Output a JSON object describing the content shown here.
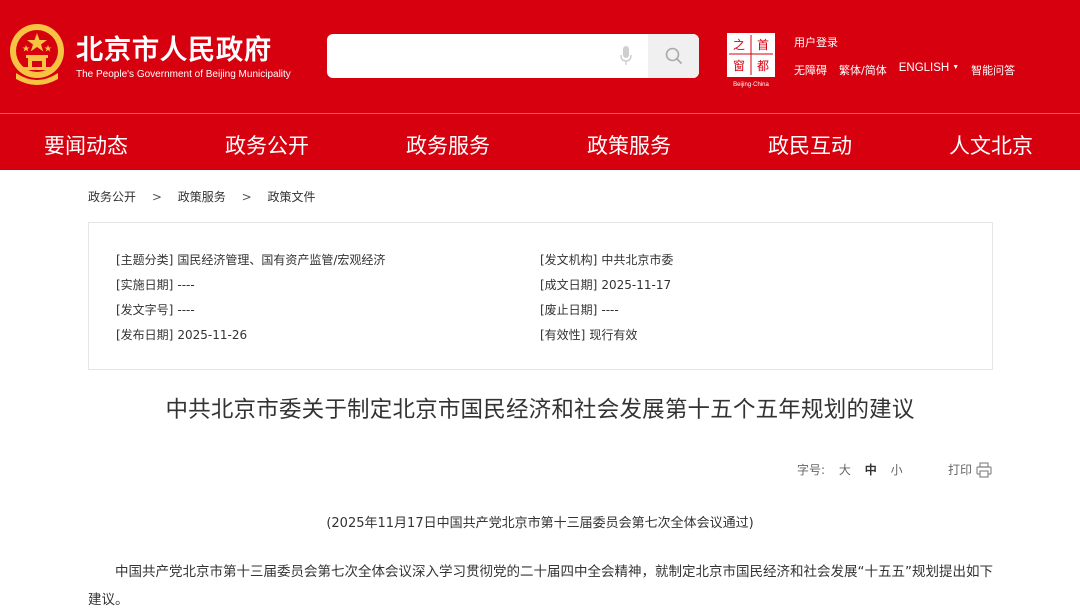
{
  "header": {
    "title": "北京市人民政府",
    "subtitle": "The People's Government of Beijing Municipality",
    "search": {
      "placeholder": "",
      "value": ""
    },
    "capital_logo": {
      "chars": [
        "之",
        "首",
        "窗",
        "都"
      ],
      "caption": "Beijing·China"
    },
    "user_login": "用户登录",
    "links": [
      "无障碍",
      "繁体/简体",
      "ENGLISH",
      "智能问答"
    ]
  },
  "nav": [
    "要闻动态",
    "政务公开",
    "政务服务",
    "政策服务",
    "政民互动",
    "人文北京"
  ],
  "breadcrumb": [
    "政务公开",
    "政策服务",
    "政策文件"
  ],
  "breadcrumb_separator": ">",
  "meta": {
    "left": [
      {
        "label": "[主题分类]",
        "value": "国民经济管理、国有资产监管/宏观经济"
      },
      {
        "label": "[实施日期]",
        "value": "----"
      },
      {
        "label": "[发文字号]",
        "value": "----"
      },
      {
        "label": "[发布日期]",
        "value": "2025-11-26"
      }
    ],
    "right": [
      {
        "label": "[发文机构]",
        "value": "中共北京市委"
      },
      {
        "label": "[成文日期]",
        "value": "2025-11-17"
      },
      {
        "label": "[废止日期]",
        "value": "----"
      },
      {
        "label": "[有效性]",
        "value": "现行有效"
      }
    ]
  },
  "article": {
    "title": "中共北京市委关于制定北京市国民经济和社会发展第十五个五年规划的建议",
    "font_size_label": "字号:",
    "font_sizes": [
      "大",
      "中",
      "小"
    ],
    "print_label": "打印",
    "adopted_note": "(2025年11月17日中国共产党北京市第十三届委员会第七次全体会议通过)",
    "paragraph": "中国共产党北京市第十三届委员会第七次全体会议深入学习贯彻党的二十届四中全会精神，就制定北京市国民经济和社会发展“十五五”规划提出如下建议。"
  },
  "colors": {
    "brand_red": "#d7000f",
    "emblem_gold": "#f6c342"
  }
}
